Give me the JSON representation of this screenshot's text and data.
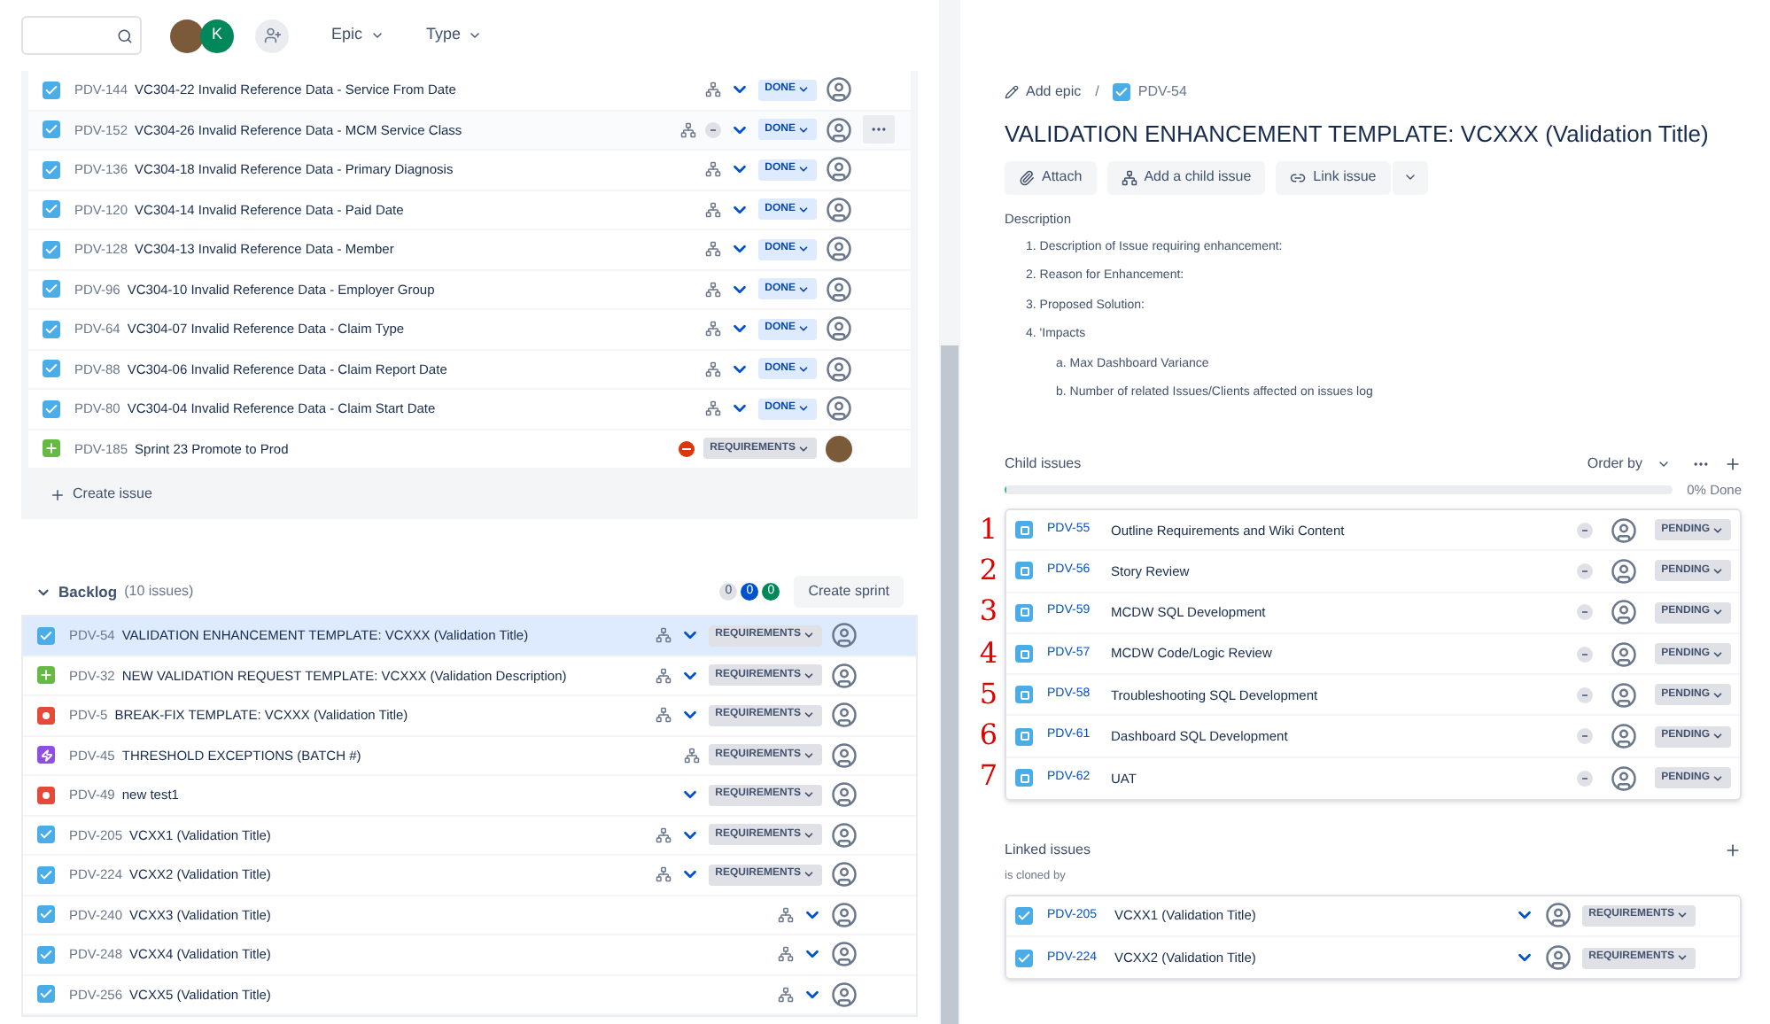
{
  "toolbar": {
    "avatars": [
      {
        "kind": "photo"
      },
      {
        "kind": "initial",
        "label": "K",
        "color": "#00875a"
      }
    ],
    "filters": [
      {
        "label": "Epic"
      },
      {
        "label": "Type"
      }
    ]
  },
  "sprint": {
    "rows": [
      {
        "type": {
          "kind": "story"
        },
        "key": "PDV-144",
        "summary": "VC304-22 Invalid Reference Data - Service From Date",
        "child": true,
        "estimate": false,
        "priority": true,
        "blocked": false,
        "status": {
          "label": "DONE",
          "kind": "done"
        },
        "assignee": {
          "kind": "none"
        },
        "hovered": false
      },
      {
        "type": {
          "kind": "story"
        },
        "key": "PDV-152",
        "summary": "VC304-26 Invalid Reference Data - MCM Service Class",
        "child": true,
        "estimate": true,
        "priority": true,
        "blocked": false,
        "status": {
          "label": "DONE",
          "kind": "done"
        },
        "assignee": {
          "kind": "none"
        },
        "hovered": true
      },
      {
        "type": {
          "kind": "story"
        },
        "key": "PDV-136",
        "summary": "VC304-18 Invalid Reference Data - Primary Diagnosis",
        "child": true,
        "estimate": false,
        "priority": true,
        "blocked": false,
        "status": {
          "label": "DONE",
          "kind": "done"
        },
        "assignee": {
          "kind": "none"
        },
        "hovered": false
      },
      {
        "type": {
          "kind": "story"
        },
        "key": "PDV-120",
        "summary": "VC304-14 Invalid Reference Data - Paid Date",
        "child": true,
        "estimate": false,
        "priority": true,
        "blocked": false,
        "status": {
          "label": "DONE",
          "kind": "done"
        },
        "assignee": {
          "kind": "none"
        },
        "hovered": false
      },
      {
        "type": {
          "kind": "story"
        },
        "key": "PDV-128",
        "summary": "VC304-13 Invalid Reference Data - Member",
        "child": true,
        "estimate": false,
        "priority": true,
        "blocked": false,
        "status": {
          "label": "DONE",
          "kind": "done"
        },
        "assignee": {
          "kind": "none"
        },
        "hovered": false
      },
      {
        "type": {
          "kind": "story"
        },
        "key": "PDV-96",
        "summary": "VC304-10 Invalid Reference Data - Employer Group",
        "child": true,
        "estimate": false,
        "priority": true,
        "blocked": false,
        "status": {
          "label": "DONE",
          "kind": "done"
        },
        "assignee": {
          "kind": "none"
        },
        "hovered": false
      },
      {
        "type": {
          "kind": "story"
        },
        "key": "PDV-64",
        "summary": "VC304-07 Invalid Reference Data - Claim Type",
        "child": true,
        "estimate": false,
        "priority": true,
        "blocked": false,
        "status": {
          "label": "DONE",
          "kind": "done"
        },
        "assignee": {
          "kind": "none"
        },
        "hovered": false
      },
      {
        "type": {
          "kind": "story"
        },
        "key": "PDV-88",
        "summary": "VC304-06 Invalid Reference Data - Claim Report Date",
        "child": true,
        "estimate": false,
        "priority": true,
        "blocked": false,
        "status": {
          "label": "DONE",
          "kind": "done"
        },
        "assignee": {
          "kind": "none"
        },
        "hovered": false
      },
      {
        "type": {
          "kind": "story"
        },
        "key": "PDV-80",
        "summary": "VC304-04 Invalid Reference Data - Claim Start Date",
        "child": true,
        "estimate": false,
        "priority": true,
        "blocked": false,
        "status": {
          "label": "DONE",
          "kind": "done"
        },
        "assignee": {
          "kind": "none"
        },
        "hovered": false
      },
      {
        "type": {
          "kind": "improvement"
        },
        "key": "PDV-185",
        "summary": "Sprint 23 Promote to Prod",
        "child": false,
        "estimate": false,
        "priority": false,
        "blocked": true,
        "status": {
          "label": "REQUIREMENTS",
          "kind": "todo"
        },
        "assignee": {
          "kind": "photo"
        },
        "hovered": false
      }
    ],
    "create_label": "Create issue"
  },
  "backlog": {
    "title": "Backlog",
    "count": "(10 issues)",
    "expanded": true,
    "counters": [
      {
        "label": "0",
        "color": "#dfe1e6"
      },
      {
        "label": "0",
        "color": "#0052cc"
      },
      {
        "label": "0",
        "color": "#00875a"
      }
    ],
    "create_sprint": "Create sprint",
    "rows": [
      {
        "type": {
          "kind": "story"
        },
        "key": "PDV-54",
        "summary": "VALIDATION ENHANCEMENT TEMPLATE: VCXXX (Validation Title)",
        "child": true,
        "priority": true,
        "status": "REQUIREMENTS",
        "selected": true
      },
      {
        "type": {
          "kind": "improvement"
        },
        "key": "PDV-32",
        "summary": "NEW VALIDATION REQUEST TEMPLATE: VCXXX (Validation Description)",
        "child": true,
        "priority": true,
        "status": "REQUIREMENTS",
        "selected": false
      },
      {
        "type": {
          "kind": "bug"
        },
        "key": "PDV-5",
        "summary": "BREAK-FIX TEMPLATE: VCXXX (Validation Title)",
        "child": true,
        "priority": true,
        "status": "REQUIREMENTS",
        "selected": false
      },
      {
        "type": {
          "kind": "epic"
        },
        "key": "PDV-45",
        "summary": "THRESHOLD EXCEPTIONS (BATCH #)",
        "child": true,
        "priority": false,
        "status": "REQUIREMENTS",
        "selected": false
      },
      {
        "type": {
          "kind": "bug"
        },
        "key": "PDV-49",
        "summary": "new test1",
        "child": false,
        "priority": true,
        "status": "REQUIREMENTS",
        "selected": false
      },
      {
        "type": {
          "kind": "story"
        },
        "key": "PDV-205",
        "summary": "VCXX1 (Validation Title)",
        "child": true,
        "priority": true,
        "status": "REQUIREMENTS",
        "selected": false
      },
      {
        "type": {
          "kind": "story"
        },
        "key": "PDV-224",
        "summary": "VCXX2 (Validation Title)",
        "child": true,
        "priority": true,
        "status": "REQUIREMENTS",
        "selected": false
      },
      {
        "type": {
          "kind": "story"
        },
        "key": "PDV-240",
        "summary": "VCXX3 (Validation Title)",
        "child": true,
        "priority": true,
        "selected": false
      },
      {
        "type": {
          "kind": "story"
        },
        "key": "PDV-248",
        "summary": "VCXX4 (Validation Title)",
        "child": true,
        "priority": true,
        "selected": false
      },
      {
        "type": {
          "kind": "story"
        },
        "key": "PDV-256",
        "summary": "VCXX5 (Validation Title)",
        "child": true,
        "priority": true,
        "selected": false
      }
    ]
  },
  "detail": {
    "breadcrumb": {
      "add_epic": "Add epic",
      "separator": "/",
      "key": "PDV-54"
    },
    "title": "VALIDATION ENHANCEMENT TEMPLATE: VCXXX (Validation Title)",
    "actions": [
      {
        "kind": "attach",
        "label": "Attach"
      },
      {
        "kind": "child",
        "label": "Add a child issue"
      },
      {
        "kind": "link",
        "label": "Link issue"
      },
      {
        "kind": "more"
      }
    ],
    "description": {
      "heading": "Description",
      "items": [
        {
          "text": "1. Description of Issue requiring enhancement:"
        },
        {
          "text": "2. Reason for Enhancement:"
        },
        {
          "text": "3. Proposed Solution:"
        },
        {
          "text": "4. 'Impacts",
          "children": [
            {
              "text": "a. Max Dashboard Variance"
            },
            {
              "text": "b. Number of related Issues/Clients affected on issues log"
            }
          ]
        }
      ]
    },
    "child_issues": {
      "heading": "Child issues",
      "order_by": "Order by",
      "level": 0,
      "progress_label": "0% Done",
      "rows": [
        {
          "annotation": "1",
          "key": "PDV-55",
          "summary": "Outline Requirements and Wiki Content",
          "status": "PENDING"
        },
        {
          "annotation": "2",
          "key": "PDV-56",
          "summary": "Story Review",
          "status": "PENDING"
        },
        {
          "annotation": "3",
          "key": "PDV-59",
          "summary": "MCDW SQL Development",
          "status": "PENDING"
        },
        {
          "annotation": "4",
          "key": "PDV-57",
          "summary": "MCDW Code/Logic Review",
          "status": "PENDING"
        },
        {
          "annotation": "5",
          "key": "PDV-58",
          "summary": "Troubleshooting SQL Development",
          "status": "PENDING"
        },
        {
          "annotation": "6",
          "key": "PDV-61",
          "summary": "Dashboard SQL Development",
          "status": "PENDING"
        },
        {
          "annotation": "7",
          "key": "PDV-62",
          "summary": "UAT",
          "status": "PENDING"
        }
      ]
    },
    "linked_issues": {
      "heading": "Linked issues",
      "relation": "is cloned by",
      "rows": [
        {
          "key": "PDV-205",
          "summary": "VCXX1 (Validation Title)",
          "status": "REQUIREMENTS"
        },
        {
          "key": "PDV-224",
          "summary": "VCXX2 (Validation Title)",
          "status": "REQUIREMENTS"
        }
      ]
    }
  }
}
